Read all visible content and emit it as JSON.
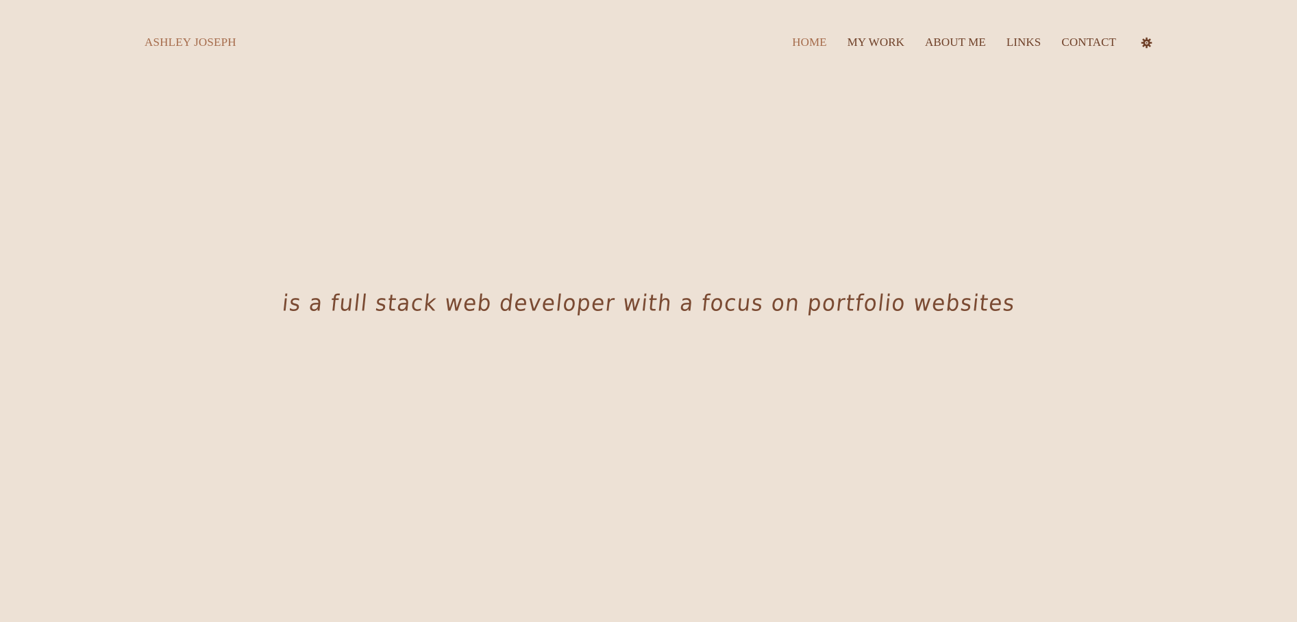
{
  "theme": {
    "background": "#ede1d5",
    "accent": "#a56b4b",
    "text": "#6e3f27",
    "headline": "#7a4a32"
  },
  "brand": {
    "label": "ASHLEY JOSEPH"
  },
  "nav": {
    "items": [
      {
        "label": "HOME",
        "active": true
      },
      {
        "label": "MY WORK",
        "active": false
      },
      {
        "label": "ABOUT ME",
        "active": false
      },
      {
        "label": "LINKS",
        "active": false
      },
      {
        "label": "CONTACT",
        "active": false
      }
    ],
    "theme_toggle_icon": "gear-icon"
  },
  "hero": {
    "tagline": "is a full stack web developer with a focus on portfolio websites"
  }
}
